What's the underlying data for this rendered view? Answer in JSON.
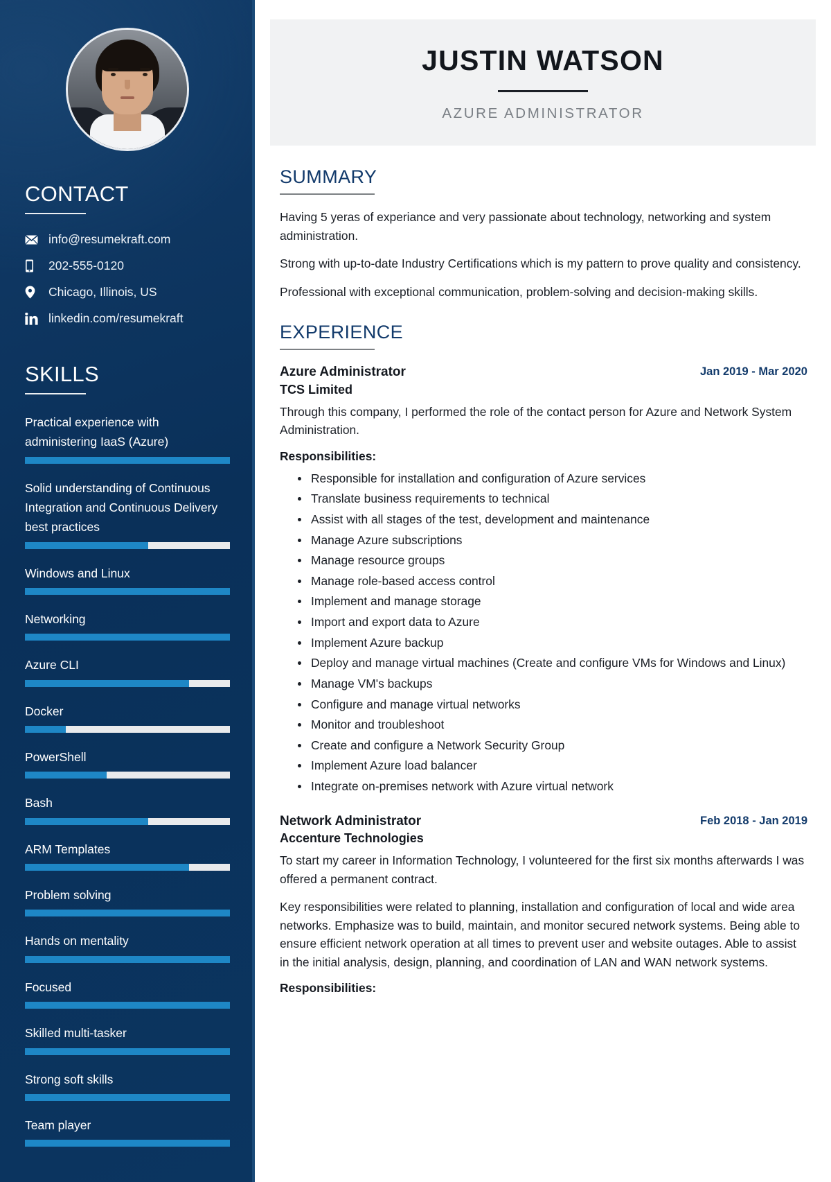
{
  "theme": {
    "sidebar_bg": "#0b3560",
    "accent_blue": "#1e87c6",
    "heading_navy": "#123a6b",
    "track_gray": "#e9eaec",
    "namecard_bg": "#f1f2f3"
  },
  "header": {
    "name": "JUSTIN WATSON",
    "role": "AZURE ADMINISTRATOR"
  },
  "sidebar": {
    "contact": {
      "heading": "CONTACT",
      "items": [
        {
          "icon": "envelope-icon",
          "text": "info@resumekraft.com"
        },
        {
          "icon": "mobile-phone-icon",
          "text": "202-555-0120"
        },
        {
          "icon": "map-pin-icon",
          "text": "Chicago, Illinois, US"
        },
        {
          "icon": "linkedin-icon",
          "text": "linkedin.com/resumekraft"
        }
      ]
    },
    "skills": {
      "heading": "SKILLS",
      "items": [
        {
          "label": "Practical experience with administering IaaS (Azure)",
          "percent": 100
        },
        {
          "label": "Solid understanding of Continuous Integration and Continuous Delivery best practices",
          "percent": 60
        },
        {
          "label": "Windows and Linux",
          "percent": 100
        },
        {
          "label": "Networking",
          "percent": 100
        },
        {
          "label": "Azure CLI",
          "percent": 80
        },
        {
          "label": "Docker",
          "percent": 20
        },
        {
          "label": "PowerShell",
          "percent": 40
        },
        {
          "label": "Bash",
          "percent": 60
        },
        {
          "label": "ARM Templates",
          "percent": 80
        },
        {
          "label": "Problem solving",
          "percent": 100
        },
        {
          "label": "Hands on mentality",
          "percent": 100
        },
        {
          "label": "Focused",
          "percent": 100
        },
        {
          "label": "Skilled multi-tasker",
          "percent": 100
        },
        {
          "label": "Strong soft skills",
          "percent": 100
        },
        {
          "label": "Team player",
          "percent": 100
        }
      ]
    }
  },
  "main": {
    "summary": {
      "heading": "SUMMARY",
      "paragraphs": [
        "Having 5 yeras of experiance and very passionate about technology, networking and system administration.",
        "Strong with up-to-date Industry Certifications which is my pattern to prove quality and consistency.",
        "Professional with exceptional communication, problem-solving and decision-making skills."
      ]
    },
    "experience": {
      "heading": "EXPERIENCE",
      "jobs": [
        {
          "title": "Azure Administrator",
          "company": "TCS Limited",
          "date": "Jan 2019 - Mar 2020",
          "paragraphs": [
            "Through this company, I performed the role of the contact person for Azure and Network System Administration."
          ],
          "responsibilities_label": "Responsibilities:",
          "responsibilities": [
            "Responsible for installation and configuration of Azure services",
            "Translate business requirements to technical",
            "Assist with all stages of the test, development and maintenance",
            "Manage Azure subscriptions",
            "Manage resource groups",
            "Manage role-based access control",
            "Implement and manage storage",
            "Import and export data to Azure",
            "Implement Azure backup",
            "Deploy and manage virtual machines (Create and configure VMs for Windows and Linux)",
            "Manage VM's backups",
            "Configure and manage virtual networks",
            "Monitor and troubleshoot",
            "Create and configure a Network Security Group",
            "Implement Azure load balancer",
            "Integrate on-premises network with Azure virtual network"
          ]
        },
        {
          "title": "Network Administrator",
          "company": "Accenture Technologies",
          "date": "Feb 2018 - Jan 2019",
          "paragraphs": [
            "To start my career in Information Technology, I volunteered for the first six months afterwards I was offered a permanent contract.",
            "Key responsibilities were related to planning, installation and configuration of local and wide area networks. Emphasize was to build, maintain, and monitor secured network systems. Being able to ensure efficient network operation at all times to prevent user and website outages. Able to assist in the initial analysis, design, planning, and coordination of LAN and WAN network systems."
          ],
          "responsibilities_label": "Responsibilities:",
          "responsibilities": []
        }
      ]
    }
  }
}
